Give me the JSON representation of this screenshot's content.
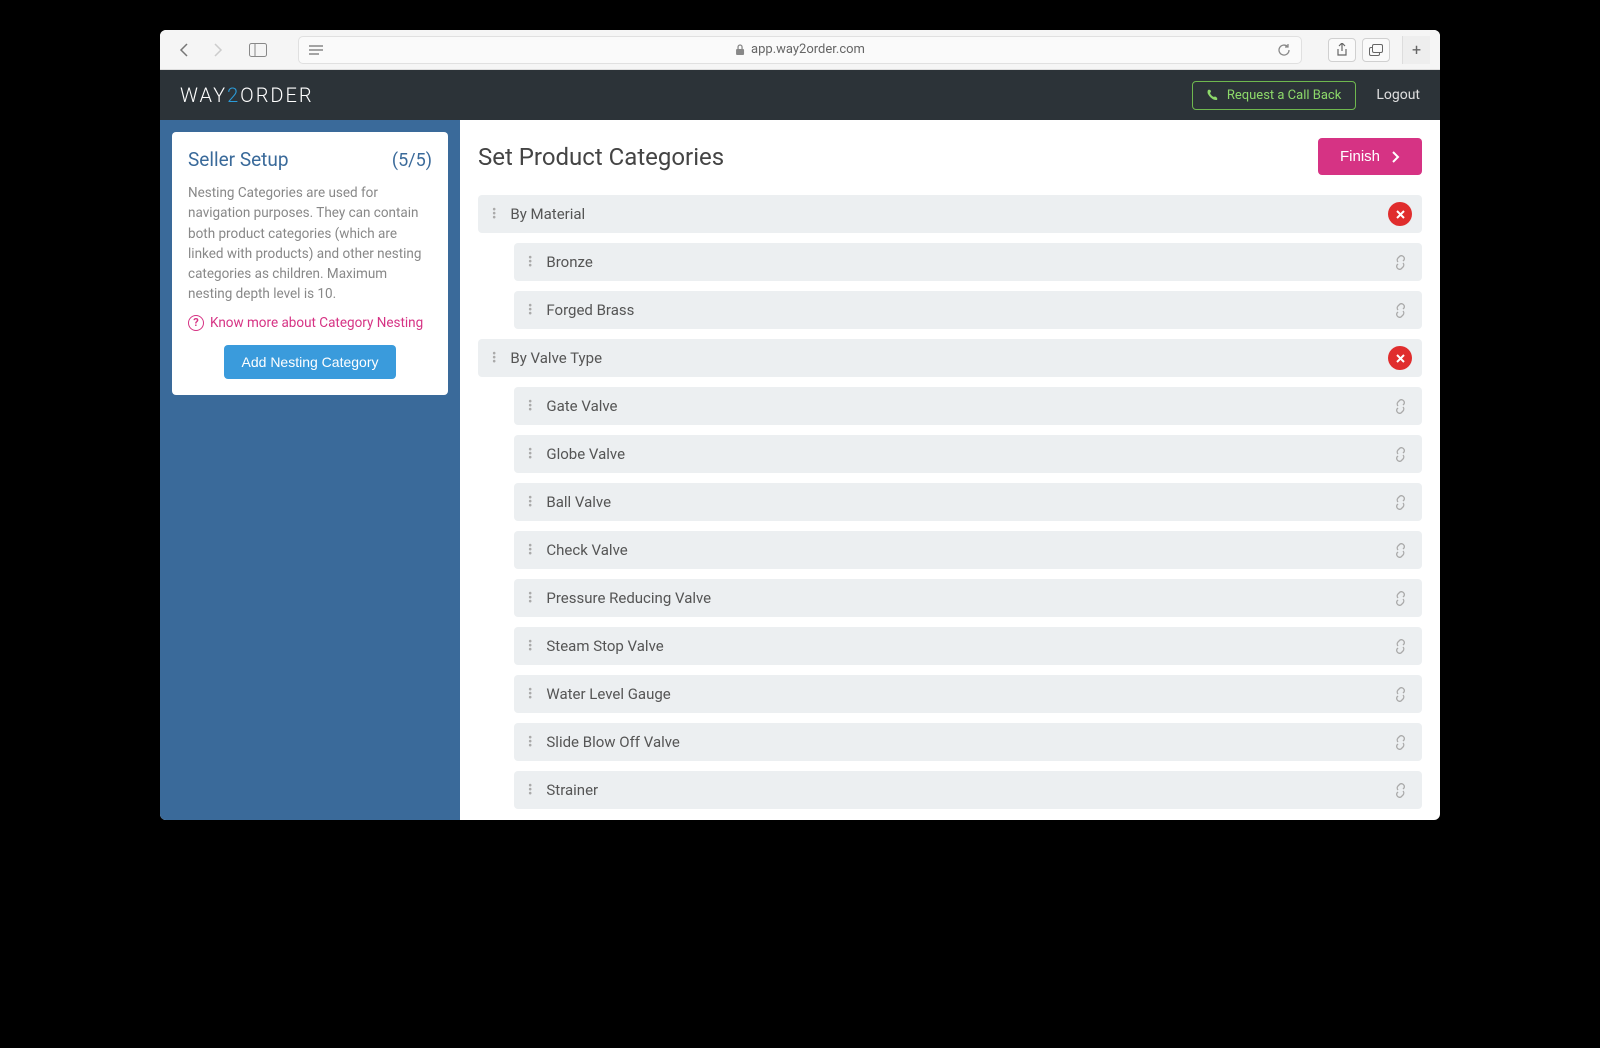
{
  "browser": {
    "url_label": "app.way2order.com"
  },
  "header": {
    "logo_part1": "WAY",
    "logo_accent": "2",
    "logo_part2": "ORDER",
    "callback_label": "Request a Call Back",
    "logout_label": "Logout"
  },
  "sidebar": {
    "title": "Seller Setup",
    "step": "(5/5)",
    "description": "Nesting Categories are used for navigation purposes. They can contain both product categories (which are linked with products) and other nesting categories as children. Maximum nesting depth level is 10.",
    "know_more_label": "Know more about Category Nesting",
    "add_btn_label": "Add Nesting Category"
  },
  "main": {
    "title": "Set Product Categories",
    "finish_label": "Finish",
    "categories": [
      {
        "name": "By Material",
        "children": [
          "Bronze",
          "Forged Brass"
        ]
      },
      {
        "name": "By Valve Type",
        "children": [
          "Gate Valve",
          "Globe Valve",
          "Ball Valve",
          "Check Valve",
          "Pressure Reducing Valve",
          "Steam Stop Valve",
          "Water Level Gauge",
          "Slide Blow Off Valve",
          "Strainer"
        ]
      }
    ]
  }
}
